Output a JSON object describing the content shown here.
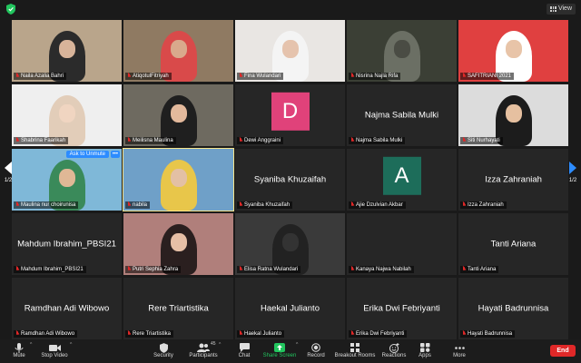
{
  "topbar": {
    "view_label": "View"
  },
  "pager": {
    "left_label": "1/2",
    "right_label": "1/2"
  },
  "tiles": [
    {
      "name": "Naila Azalia Bahri",
      "type": "video",
      "bg": "#b9a58b",
      "hijab": "#2b2b2b",
      "face": "#d8b49a"
    },
    {
      "name": "AtiqotulFitriyah",
      "type": "video",
      "bg": "#8f7a62",
      "hijab": "#d94a4a",
      "face": "#d9a98c"
    },
    {
      "name": "Fina Wulandari",
      "type": "video",
      "bg": "#e9e6e3",
      "hijab": "#f4f4f4",
      "face": "#e5c3ad"
    },
    {
      "name": "Nisrina Najla Rifa",
      "type": "video",
      "bg": "#3b3f35",
      "hijab": "#6b6f64",
      "face": "#4a4c44"
    },
    {
      "name": "SAFITRIANI 2021",
      "type": "video",
      "bg": "#e04040",
      "hijab": "#ffffff",
      "face": "#e8c4a8"
    },
    {
      "name": "Shabrina Faarikah",
      "type": "video",
      "bg": "#efefef",
      "hijab": "#e2cdb9",
      "face": "#f0d5c1"
    },
    {
      "name": "Meilisna Maulina",
      "type": "video",
      "bg": "#6e6a60",
      "hijab": "#1f1f1f",
      "face": "#e3b99c"
    },
    {
      "name": "Dewi Anggraini",
      "type": "avatar",
      "letter": "D",
      "avatar_color": "#e0427a"
    },
    {
      "name": "Najma Sabila Mulki",
      "type": "text"
    },
    {
      "name": "Siti Nurhayati",
      "type": "video",
      "bg": "#dcdcdc",
      "hijab": "#1c1c1c",
      "face": "#e6c0a0"
    },
    {
      "name": "Maulina nur choirunisa",
      "type": "video",
      "bg": "#7fb8d8",
      "hijab": "#3a8a5a",
      "face": "#e0b896",
      "ask_unmute": "Ask to Unmute",
      "more": "•••"
    },
    {
      "name": "nabila",
      "type": "video",
      "bg": "#6fa0c8",
      "hijab": "#e8c64a",
      "face": "#e3c0a4",
      "speaking": true
    },
    {
      "name": "Syaniba Khuzaifah",
      "type": "text"
    },
    {
      "name": "Ajie Dzulvian Akbar",
      "type": "avatar",
      "letter": "A",
      "avatar_color": "#1d6d5a"
    },
    {
      "name": "Izza Zahraniah",
      "type": "text"
    },
    {
      "name": "Mahdum Ibrahim_PBSI21",
      "type": "text"
    },
    {
      "name": "Putri Sephia Zahra",
      "type": "video",
      "bg": "#b07f7b",
      "hijab": "#2a1f1f",
      "face": "#e6bfa6"
    },
    {
      "name": "Elisa Ratna Wulandari",
      "type": "video",
      "bg": "#3a3a3a",
      "hijab": "#222222",
      "face": "#333333"
    },
    {
      "name": "Kanaya Najwa Nabilah",
      "type": "blank"
    },
    {
      "name": "Tanti Ariana",
      "type": "text"
    },
    {
      "name": "Ramdhan Adi Wibowo",
      "type": "text"
    },
    {
      "name": "Rere Triartistika",
      "type": "text"
    },
    {
      "name": "Haekal Julianto",
      "type": "text"
    },
    {
      "name": "Erika Dwi Febriyanti",
      "type": "text"
    },
    {
      "name": "Hayati Badrunnisa",
      "type": "text"
    }
  ],
  "toolbar": {
    "mute": "Mute",
    "stop_video": "Stop Video",
    "security": "Security",
    "participants": "Participants",
    "participants_count": "45",
    "chat": "Chat",
    "share_screen": "Share Screen",
    "record": "Record",
    "breakout_rooms": "Breakout Rooms",
    "reactions": "Reactions",
    "apps": "Apps",
    "more": "More",
    "end": "End"
  },
  "colors": {
    "share_green": "#22c55e",
    "end_red": "#e02828",
    "accent_blue": "#2d8cff"
  }
}
